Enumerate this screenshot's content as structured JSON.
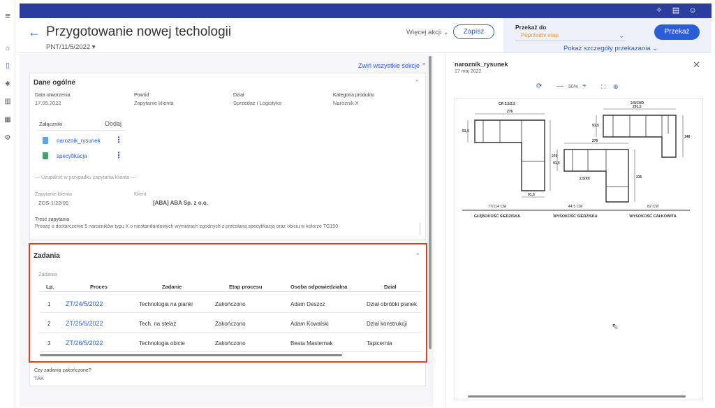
{
  "app": {
    "title": "Przygotowanie nowej techologii",
    "doc_number": "PNT/11/5/2022",
    "more_actions": "Więcej akcji",
    "save_label": "Zapisz"
  },
  "topbar": {
    "icons": [
      "sparkle-icon",
      "document-clock-icon",
      "user-icon"
    ]
  },
  "sidebar": {
    "icons": [
      "menu-icon",
      "home-icon",
      "document-icon",
      "layers-icon",
      "chart-icon",
      "calendar-icon",
      "gear-icon"
    ]
  },
  "transfer": {
    "label": "Przekaż do",
    "selected": "Poprzedni etap",
    "button": "Przekaż",
    "details": "Pokaż szczegóły przekazania"
  },
  "form": {
    "collapse_all": "Zwiń wszystkie sekcje",
    "general_title": "Dane ogólne",
    "fields": {
      "created_label": "Data utworzenia",
      "created_value": "17.05.2022",
      "reason_label": "Powód",
      "reason_value": "Zapytanie klienta",
      "dept_label": "Dział",
      "dept_value": "Sprzedaż i Logistyka",
      "category_label": "Kategoria produktu",
      "category_value": "Narożnik X"
    },
    "attachments": {
      "label": "Załączniki",
      "add": "Dodaj",
      "items": [
        {
          "name": "naroznik_rysunek"
        },
        {
          "name": "specyfikacja"
        }
      ]
    },
    "inquiry_note": "— Uzupełnić w przypadku zapytania klienta —",
    "inquiry_label": "Zapytanie klienta",
    "inquiry_value": "ZOS-1/22/05",
    "client_label": "Klient",
    "client_value": "[ABA] ABA Sp. z o.o.",
    "content_label": "Treść zapytania",
    "content_value": "Proszę o dostarczenie 5 narożników typu X o niestandardowych wymiarach zgodnych z przesłaną specyfikacją oraz obiciu w kolorze TG150"
  },
  "tasks": {
    "title": "Zadania",
    "subtitle": "Zadania",
    "headers": [
      "Lp.",
      "Proces",
      "Zadanie",
      "Etap procesu",
      "Osoba odpowiedzialna",
      "Dział"
    ],
    "rows": [
      {
        "lp": "1",
        "proces": "ZT/24/5/2022",
        "zadanie": "Technologia na pianki",
        "etap": "Zakończono",
        "osoba": "Adam Deszcz",
        "dzial": "Dział obróbki pianek"
      },
      {
        "lp": "2",
        "proces": "ZT/25/5/2022",
        "zadanie": "Tech. na stelaż",
        "etap": "Zakończono",
        "osoba": "Adam Kowalski",
        "dzial": "Dział konstrukcji"
      },
      {
        "lp": "3",
        "proces": "ZT/26/5/2022",
        "zadanie": "Technologia obicie",
        "etap": "Zakończono",
        "osoba": "Beata Masternak",
        "dzial": "Tapicernia"
      }
    ]
  },
  "completed": {
    "label": "Czy zadania zakończone?",
    "value": "TAK"
  },
  "preview": {
    "name": "naroznik_rysunek",
    "date": "17 maj 2022",
    "zoom": "50%",
    "drawing": {
      "label_a": "CR 2.5/2.5",
      "label_b": "2.5/CHD",
      "label_c": "2.5/XX",
      "dims": [
        "276",
        "291,5",
        "276",
        "91,5",
        "91,5",
        "91,5",
        "276",
        "148",
        "235",
        "91,5"
      ],
      "meas": [
        {
          "value": "77/114 CM",
          "caption": "GŁĘBOKOŚĆ SIEDZISKA"
        },
        {
          "value": "44,5 CM",
          "caption": "WYSOKOŚĆ SIEDZISKA"
        },
        {
          "value": "82 CM",
          "caption": "WYSOKOŚĆ CAŁKOWITA"
        }
      ]
    }
  }
}
